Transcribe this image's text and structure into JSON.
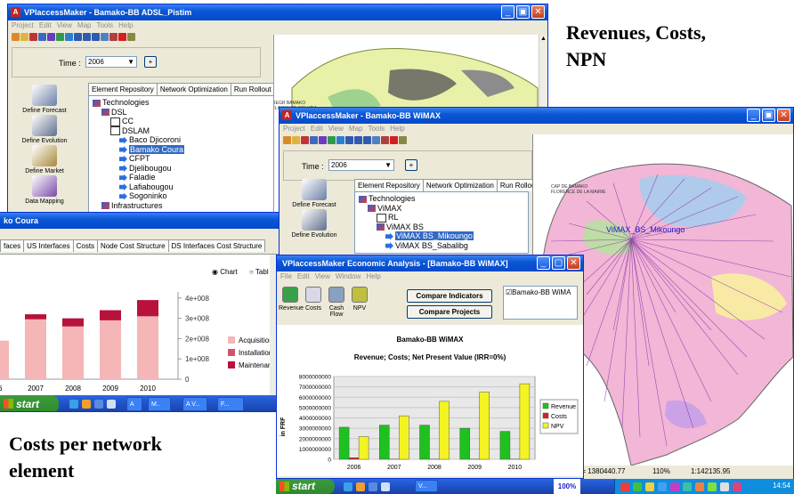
{
  "captions": {
    "top_right": [
      "Revenues, Costs,",
      "NPN"
    ],
    "bottom_left": [
      "Costs per network",
      "element"
    ]
  },
  "windows": {
    "adsl": {
      "title": "VPlaccessMaker - Bamako-BB ADSL_Pistim",
      "menu": [
        "Project",
        "Edit",
        "View",
        "Map",
        "Tools",
        "Help"
      ],
      "time_label": "Time :",
      "time_value": "2006",
      "plus_button": "+",
      "tabs": [
        "Element Repository",
        "Network Optimization",
        "Run Rollout"
      ],
      "sidebar": [
        "Define Forecast",
        "Define Evolution",
        "Define Market",
        "Data Mapping"
      ],
      "tree": [
        {
          "label": "Technologies",
          "indent": 0,
          "icon": "tech"
        },
        {
          "label": "DSL",
          "indent": 1,
          "icon": "tech"
        },
        {
          "label": "CC",
          "indent": 2,
          "icon": "box"
        },
        {
          "label": "DSLAM",
          "indent": 2,
          "icon": "box"
        },
        {
          "label": "Baco Djicoroni",
          "indent": 3,
          "icon": "arrow"
        },
        {
          "label": "Bamako Coura",
          "indent": 3,
          "icon": "arrow",
          "selected": true
        },
        {
          "label": "CFPT",
          "indent": 3,
          "icon": "arrow"
        },
        {
          "label": "Djelibougou",
          "indent": 3,
          "icon": "arrow"
        },
        {
          "label": "Faladie",
          "indent": 3,
          "icon": "arrow"
        },
        {
          "label": "Lafiabougou",
          "indent": 3,
          "icon": "arrow"
        },
        {
          "label": "Sogoninko",
          "indent": 3,
          "icon": "arrow"
        },
        {
          "label": "Infrastructures",
          "indent": 1,
          "icon": "tech"
        }
      ]
    },
    "coura": {
      "title": "ko Coura",
      "tabs": [
        "faces",
        "US Interfaces",
        "Costs",
        "Node Cost Structure",
        "DS Interfaces Cost Structure"
      ],
      "radio_chart": "Chart",
      "radio_table": "Tabl",
      "chart_data": {
        "type": "bar",
        "stacked": true,
        "categories": [
          "06",
          "2007",
          "2008",
          "2009",
          "2010"
        ],
        "series": [
          {
            "name": "Acquisition",
            "color": "#f4b6b6",
            "values": [
              190000000,
              295000000,
              260000000,
              290000000,
              310000000
            ]
          },
          {
            "name": "Installation",
            "color": "#d1546a",
            "values": [
              0,
              0,
              0,
              0,
              0
            ]
          },
          {
            "name": "Maintenar",
            "color": "#b8123c",
            "values": [
              0,
              25000000,
              40000000,
              50000000,
              80000000
            ]
          }
        ],
        "yticks": [
          "4e+008",
          "3e+008",
          "2e+008",
          "1e+008",
          "0"
        ],
        "ylim": [
          0,
          430000000
        ]
      }
    },
    "wimax": {
      "title": "VPlaccessMaker - Bamako-BB WiMAX",
      "menu": [
        "Project",
        "Edit",
        "View",
        "Map",
        "Tools",
        "Help"
      ],
      "time_label": "Time :",
      "time_value": "2006",
      "plus_button": "+",
      "tabs": [
        "Element Repository",
        "Network Optimization",
        "Run Rollout"
      ],
      "sidebar": [
        "Define Forecast",
        "Define Evolution"
      ],
      "tree": [
        {
          "label": "Technologies",
          "indent": 0,
          "icon": "tech"
        },
        {
          "label": "ViMAX",
          "indent": 1,
          "icon": "tech"
        },
        {
          "label": "RL",
          "indent": 2,
          "icon": "box"
        },
        {
          "label": "ViMAX BS",
          "indent": 2,
          "icon": "tech"
        },
        {
          "label": "ViMAX BS_Mikoungo",
          "indent": 3,
          "icon": "arrow",
          "selected": true
        },
        {
          "label": "ViMAX BS_Sabalibg",
          "indent": 3,
          "icon": "arrow"
        }
      ],
      "map_label": "ViMAX_BS_Mikoungo",
      "status": {
        "y": "Y= 1380440.77",
        "zoom": "110%",
        "scale": "1:142135.95"
      }
    },
    "econ": {
      "title": "VPlaccessMaker Economic Analysis - [Bamako-BB WiMAX]",
      "menu": [
        "File",
        "Edit",
        "View",
        "Window",
        "Help"
      ],
      "icons": [
        "Revenue",
        "Costs",
        "Cash Flow",
        "NPV"
      ],
      "compare_indicators": "Compare Indicators",
      "compare_projects": "Compare Projects",
      "checklist_item": "Bamako-BB WiMA",
      "chart_title": "Bamako-BB WiMAX",
      "chart_subtitle": "Revenue; Costs; Net Present Value (IRR=0%)",
      "chart_data": {
        "type": "bar",
        "categories": [
          "2006",
          "2007",
          "2008",
          "2009",
          "2010"
        ],
        "ylabel": "in FRF",
        "ylim": [
          0,
          8000000000
        ],
        "yticks": [
          "8000000000",
          "7000000000",
          "6000000000",
          "5000000000",
          "4000000000",
          "3000000000",
          "2000000000",
          "1000000000",
          "0"
        ],
        "series": [
          {
            "name": "Revenue",
            "color": "#1fc11f",
            "values": [
              3100000000,
              3300000000,
              3300000000,
              3000000000,
              2700000000
            ]
          },
          {
            "name": "Costs",
            "color": "#d62020",
            "values": [
              150000000,
              20000000,
              20000000,
              20000000,
              20000000
            ]
          },
          {
            "name": "NPV",
            "color": "#f4f422",
            "values": [
              2200000000,
              4200000000,
              5600000000,
              6500000000,
              7300000000
            ]
          }
        ]
      }
    }
  },
  "taskbars": {
    "left": {
      "start": "start",
      "apps": [
        "A",
        "M..",
        "A V...",
        "F..."
      ]
    },
    "bottom": {
      "start": "start",
      "apps": [
        "V..."
      ],
      "zoom": "100%",
      "clock": "14:54"
    }
  }
}
